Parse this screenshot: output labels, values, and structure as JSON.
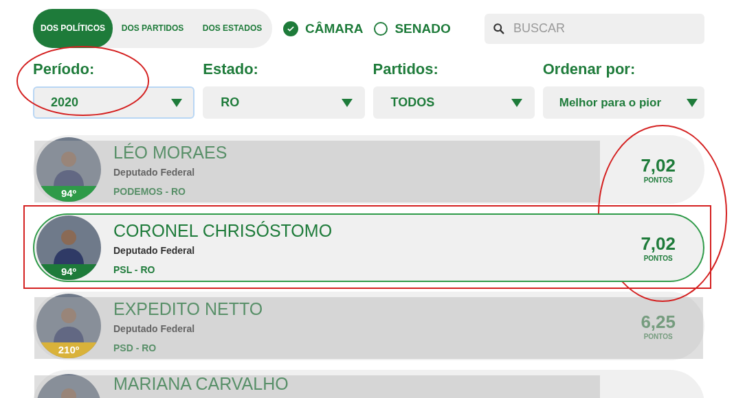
{
  "tabs": [
    {
      "label": "DOS POLÍTICOS",
      "selected": true
    },
    {
      "label": "DOS PARTIDOS",
      "selected": false
    },
    {
      "label": "DOS ESTADOS",
      "selected": false
    }
  ],
  "houses": [
    {
      "label": "CÂMARA",
      "checked": true
    },
    {
      "label": "SENADO",
      "checked": false
    }
  ],
  "search": {
    "placeholder": "BUSCAR"
  },
  "filters": [
    {
      "label": "Período:",
      "value": "2020",
      "focused": true,
      "circled": true
    },
    {
      "label": "Estado:",
      "value": "RO",
      "focused": false,
      "circled": false
    },
    {
      "label": "Partidos:",
      "value": "TODOS",
      "focused": false,
      "circled": false
    },
    {
      "label": "Ordenar por:",
      "value": "Melhor para o pior",
      "focused": false,
      "circled": false
    }
  ],
  "politicians": [
    {
      "name": "LÉO MORAES",
      "role": "Deputado Federal",
      "party": "PODEMOS - RO",
      "rank": "94º",
      "color": "#2e9a48",
      "score": "7,02",
      "score_label": "PONTOS",
      "dimmed": true,
      "score_dimmed": false,
      "boxed": false
    },
    {
      "name": "CORONEL CHRISÓSTOMO",
      "role": "Deputado Federal",
      "party": "PSL - RO",
      "rank": "94º",
      "color": "#1e7b3a",
      "score": "7,02",
      "score_label": "PONTOS",
      "dimmed": false,
      "score_dimmed": false,
      "boxed": true
    },
    {
      "name": "EXPEDITO NETTO",
      "role": "Deputado Federal",
      "party": "PSD - RO",
      "rank": "210º",
      "color": "#d9b23a",
      "score": "6,25",
      "score_label": "PONTOS",
      "dimmed": true,
      "score_dimmed": true,
      "boxed": false
    },
    {
      "name": "MARIANA CARVALHO",
      "dimmed": true,
      "boxed": false
    }
  ],
  "scores_circled": true
}
